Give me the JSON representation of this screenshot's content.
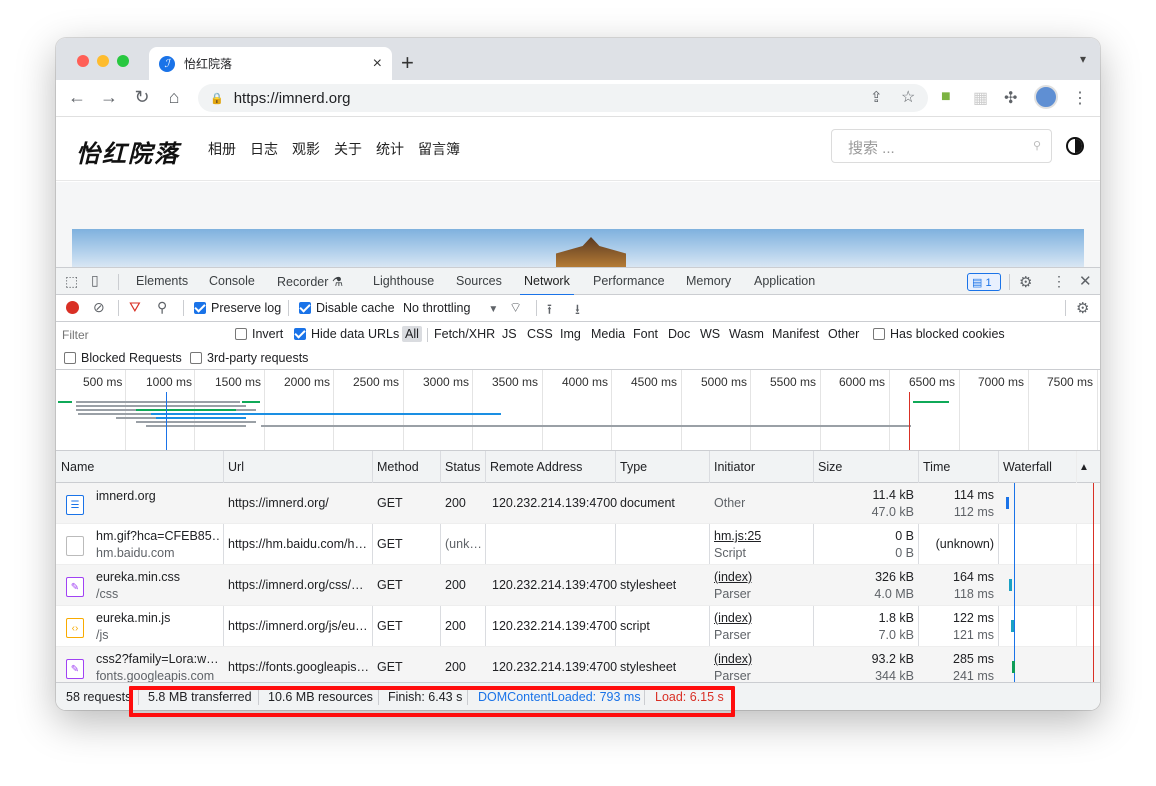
{
  "browser": {
    "tab_title": "怡红院落",
    "tab_close": "×",
    "new_tab": "+",
    "url": "https://imnerd.org"
  },
  "site": {
    "logo_text": "怡红院落",
    "nav": [
      "相册",
      "日志",
      "观影",
      "关于",
      "统计",
      "留言簿"
    ],
    "search_placeholder": "搜索 ..."
  },
  "devtools": {
    "tabs": [
      "Elements",
      "Console",
      "Recorder",
      "Lighthouse",
      "Sources",
      "Network",
      "Performance",
      "Memory",
      "Application"
    ],
    "active_tab": "Network",
    "recorder_badge": "⚗",
    "issues_count": "1",
    "toolbar": {
      "preserve_log": "Preserve log",
      "disable_cache": "Disable cache",
      "throttling": "No throttling"
    },
    "filter": {
      "placeholder": "Filter",
      "invert": "Invert",
      "hide_data_urls": "Hide data URLs",
      "types": [
        "All",
        "Fetch/XHR",
        "JS",
        "CSS",
        "Img",
        "Media",
        "Font",
        "Doc",
        "WS",
        "Wasm",
        "Manifest",
        "Other"
      ],
      "has_blocked_cookies": "Has blocked cookies",
      "blocked_requests": "Blocked Requests",
      "third_party": "3rd-party requests"
    },
    "overview_ticks": [
      "500 ms",
      "1000 ms",
      "1500 ms",
      "2000 ms",
      "2500 ms",
      "3000 ms",
      "3500 ms",
      "4000 ms",
      "4500 ms",
      "5000 ms",
      "5500 ms",
      "6000 ms",
      "6500 ms",
      "7000 ms",
      "7500 ms"
    ],
    "columns": [
      "Name",
      "Url",
      "Method",
      "Status",
      "Remote Address",
      "Type",
      "Initiator",
      "Size",
      "Time",
      "Waterfall"
    ],
    "rows": [
      {
        "name": "imnerd.org",
        "domain": "",
        "url": "https://imnerd.org/",
        "method": "GET",
        "status": "200",
        "remote": "120.232.214.139:4700",
        "type": "document",
        "initiator": "Other",
        "initiator_sub": "",
        "size": "11.4 kB",
        "size_sub": "47.0 kB",
        "time": "114 ms",
        "time_sub": "112 ms",
        "icon": "document-icon",
        "icon_color": "#1a73e8"
      },
      {
        "name": "hm.gif?hca=CFEB85…",
        "domain": "hm.baidu.com",
        "url": "https://hm.baidu.com/h…",
        "method": "GET",
        "status": "(unk…",
        "remote": "",
        "type": "",
        "initiator": "hm.js:25",
        "initiator_sub": "Script",
        "size": "0 B",
        "size_sub": "0 B",
        "time": "(unknown)",
        "time_sub": "",
        "icon": "image-icon",
        "icon_color": "#ffffff"
      },
      {
        "name": "eureka.min.css",
        "domain": "/css",
        "url": "https://imnerd.org/css/…",
        "method": "GET",
        "status": "200",
        "remote": "120.232.214.139:4700",
        "type": "stylesheet",
        "initiator": "(index)",
        "initiator_sub": "Parser",
        "size": "326 kB",
        "size_sub": "4.0 MB",
        "time": "164 ms",
        "time_sub": "118 ms",
        "icon": "stylesheet-icon",
        "icon_color": "#a142f4"
      },
      {
        "name": "eureka.min.js",
        "domain": "/js",
        "url": "https://imnerd.org/js/eu…",
        "method": "GET",
        "status": "200",
        "remote": "120.232.214.139:4700",
        "type": "script",
        "initiator": "(index)",
        "initiator_sub": "Parser",
        "size": "1.8 kB",
        "size_sub": "7.0 kB",
        "time": "122 ms",
        "time_sub": "121 ms",
        "icon": "script-icon",
        "icon_color": "#f9ab00"
      },
      {
        "name": "css2?family=Lora:w…",
        "domain": "fonts.googleapis.com",
        "url": "https://fonts.googleapis…",
        "method": "GET",
        "status": "200",
        "remote": "120.232.214.139:4700",
        "type": "stylesheet",
        "initiator": "(index)",
        "initiator_sub": "Parser",
        "size": "93.2 kB",
        "size_sub": "344 kB",
        "time": "285 ms",
        "time_sub": "241 ms",
        "icon": "stylesheet-icon",
        "icon_color": "#a142f4"
      }
    ],
    "status": {
      "requests": "58 requests",
      "transferred": "5.8 MB transferred",
      "resources": "10.6 MB resources",
      "finish": "Finish: 6.43 s",
      "dom_content_loaded": "DOMContentLoaded: 793 ms",
      "load": "Load: 6.15 s"
    }
  },
  "colors": {
    "accent": "#1a73e8",
    "dcl_blue": "#1a73e8",
    "load_red": "#d93025",
    "highlight_red": "#ff0d0d"
  }
}
